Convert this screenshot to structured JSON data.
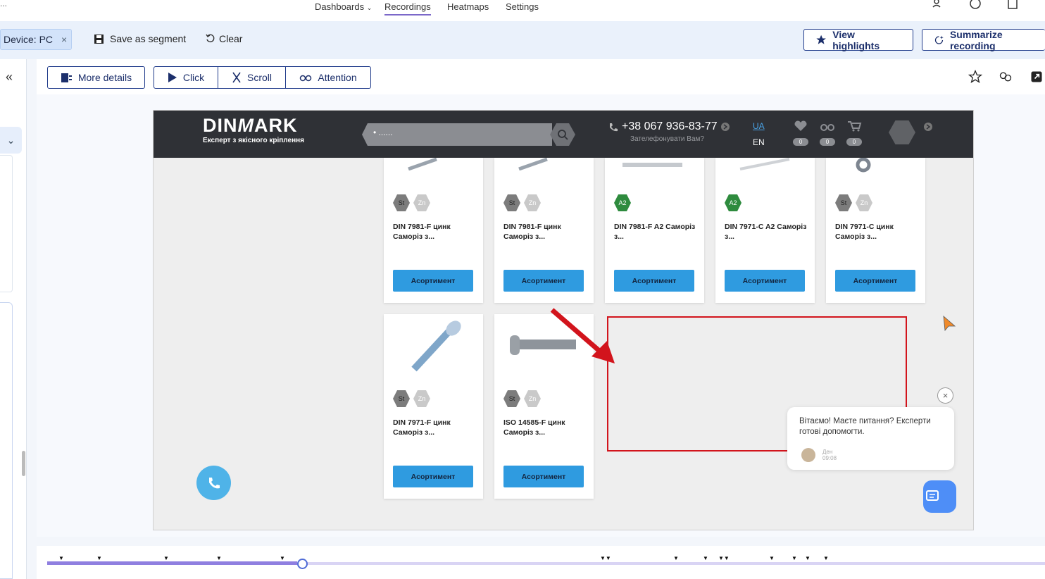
{
  "topnav": {
    "edge": "...",
    "items": [
      "Dashboards",
      "Recordings",
      "Heatmaps",
      "Settings"
    ]
  },
  "filterbar": {
    "chip_label": "Device: PC",
    "chip_close": "×",
    "save_segment": "Save as segment",
    "clear": "Clear",
    "view_highlights": "View highlights",
    "summarize": "Summarize recording"
  },
  "toolbar": {
    "more_details": "More details",
    "click": "Click",
    "scroll": "Scroll",
    "attention": "Attention"
  },
  "site": {
    "logo": "DIN",
    "logo_m": "M",
    "logo_rest": "ARK",
    "logo_sub": "Експерт з якісного кріплення",
    "search_value": "• ......",
    "phone": "+38 067 936-83-77",
    "callback": "Зателефонувати Вам?",
    "lang_ua": "UA",
    "lang_en": "EN",
    "badge_counts": [
      "0",
      "0",
      "0"
    ]
  },
  "products": [
    {
      "name": "DIN 7981-F цинк Саморіз з...",
      "badges": [
        "St",
        "Zn"
      ],
      "button": "Асортимент"
    },
    {
      "name": "DIN 7981-F цинк Саморіз з...",
      "badges": [
        "St",
        "Zn"
      ],
      "button": "Асортимент"
    },
    {
      "name": "DIN 7981-F A2 Саморіз з...",
      "badges": [
        "A2"
      ],
      "button": "Асортимент"
    },
    {
      "name": "DIN 7971-C A2 Саморіз з...",
      "badges": [
        "A2"
      ],
      "button": "Асортимент"
    },
    {
      "name": "DIN 7971-C цинк Саморіз з...",
      "badges": [
        "St",
        "Zn"
      ],
      "button": "Асортимент"
    },
    {
      "name": "DIN 7971-F цинк Саморіз з...",
      "badges": [
        "St",
        "Zn"
      ],
      "button": "Асортимент"
    },
    {
      "name": "ISO 14585-F цинк Саморіз з...",
      "badges": [
        "St",
        "Zn"
      ],
      "button": "Асортимент"
    }
  ],
  "chat": {
    "message": "Вітаємо! Маєте питання? Експерти готові допомогти.",
    "author": "Ден",
    "time": "09:08",
    "close": "×"
  },
  "colors": {
    "accent": "#1f3a8a",
    "highlight": "#d2141c",
    "site_header": "#2f3136",
    "product_button": "#2f9be0"
  }
}
